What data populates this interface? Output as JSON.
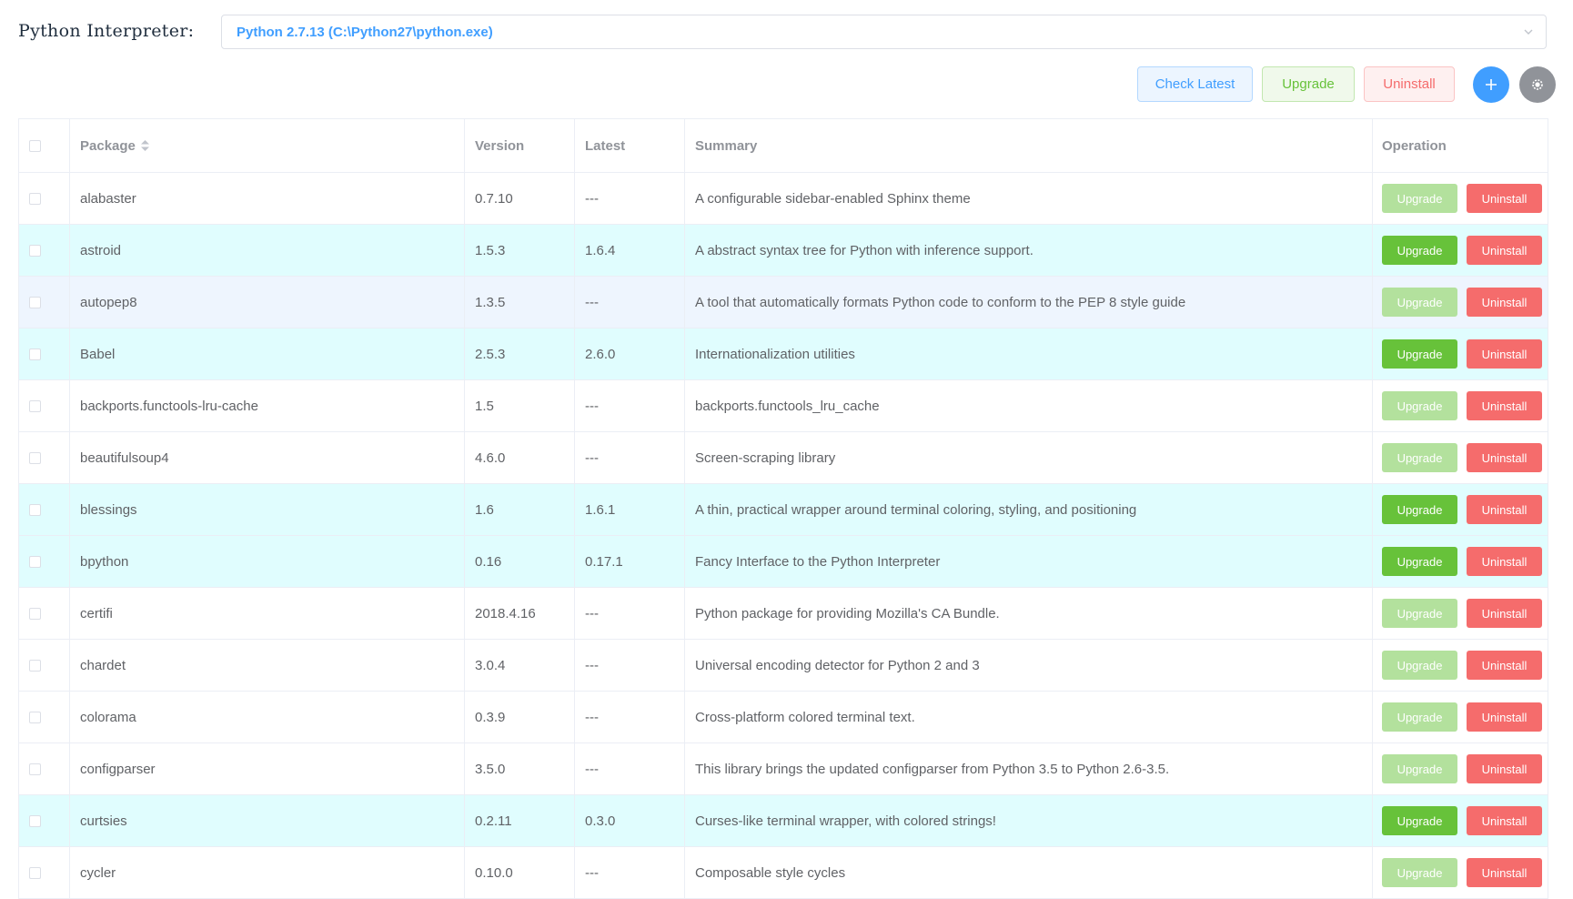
{
  "interpreter": {
    "label": "Python Interpreter:",
    "selected": "Python 2.7.13 (C:\\Python27\\python.exe)"
  },
  "toolbar": {
    "check_latest": "Check Latest",
    "upgrade": "Upgrade",
    "uninstall": "Uninstall"
  },
  "table": {
    "headers": {
      "package": "Package",
      "version": "Version",
      "latest": "Latest",
      "summary": "Summary",
      "operation": "Operation"
    },
    "row_actions": {
      "upgrade": "Upgrade",
      "uninstall": "Uninstall"
    },
    "rows": [
      {
        "package": "alabaster",
        "version": "0.7.10",
        "latest": "---",
        "summary": "A configurable sidebar-enabled Sphinx theme",
        "upgradable": false,
        "highlight": "none"
      },
      {
        "package": "astroid",
        "version": "1.5.3",
        "latest": "1.6.4",
        "summary": "A abstract syntax tree for Python with inference support.",
        "upgradable": true,
        "highlight": "new"
      },
      {
        "package": "autopep8",
        "version": "1.3.5",
        "latest": "---",
        "summary": "A tool that automatically formats Python code to conform to the PEP 8 style guide",
        "upgradable": false,
        "highlight": "hover"
      },
      {
        "package": "Babel",
        "version": "2.5.3",
        "latest": "2.6.0",
        "summary": "Internationalization utilities",
        "upgradable": true,
        "highlight": "new"
      },
      {
        "package": "backports.functools-lru-cache",
        "version": "1.5",
        "latest": "---",
        "summary": "backports.functools_lru_cache",
        "upgradable": false,
        "highlight": "none"
      },
      {
        "package": "beautifulsoup4",
        "version": "4.6.0",
        "latest": "---",
        "summary": "Screen-scraping library",
        "upgradable": false,
        "highlight": "none"
      },
      {
        "package": "blessings",
        "version": "1.6",
        "latest": "1.6.1",
        "summary": "A thin, practical wrapper around terminal coloring, styling, and positioning",
        "upgradable": true,
        "highlight": "new"
      },
      {
        "package": "bpython",
        "version": "0.16",
        "latest": "0.17.1",
        "summary": "Fancy Interface to the Python Interpreter",
        "upgradable": true,
        "highlight": "new"
      },
      {
        "package": "certifi",
        "version": "2018.4.16",
        "latest": "---",
        "summary": "Python package for providing Mozilla's CA Bundle.",
        "upgradable": false,
        "highlight": "none"
      },
      {
        "package": "chardet",
        "version": "3.0.4",
        "latest": "---",
        "summary": "Universal encoding detector for Python 2 and 3",
        "upgradable": false,
        "highlight": "none"
      },
      {
        "package": "colorama",
        "version": "0.3.9",
        "latest": "---",
        "summary": "Cross-platform colored terminal text.",
        "upgradable": false,
        "highlight": "none"
      },
      {
        "package": "configparser",
        "version": "3.5.0",
        "latest": "---",
        "summary": "This library brings the updated configparser from Python 3.5 to Python 2.6-3.5.",
        "upgradable": false,
        "highlight": "none"
      },
      {
        "package": "curtsies",
        "version": "0.2.11",
        "latest": "0.3.0",
        "summary": "Curses-like terminal wrapper, with colored strings!",
        "upgradable": true,
        "highlight": "new"
      },
      {
        "package": "cycler",
        "version": "0.10.0",
        "latest": "---",
        "summary": "Composable style cycles",
        "upgradable": false,
        "highlight": "none"
      }
    ]
  },
  "colors": {
    "primary": "#409eff",
    "success": "#67c23a",
    "success_disabled": "#b3e19d",
    "danger": "#f56c6c",
    "info": "#909399",
    "row_new": "#e0fdfe",
    "row_hover": "#eef5fe"
  },
  "icons": {
    "select": "chevron-down-icon",
    "add": "plus-icon",
    "settings": "gear-icon",
    "sort": "sort-icon"
  }
}
